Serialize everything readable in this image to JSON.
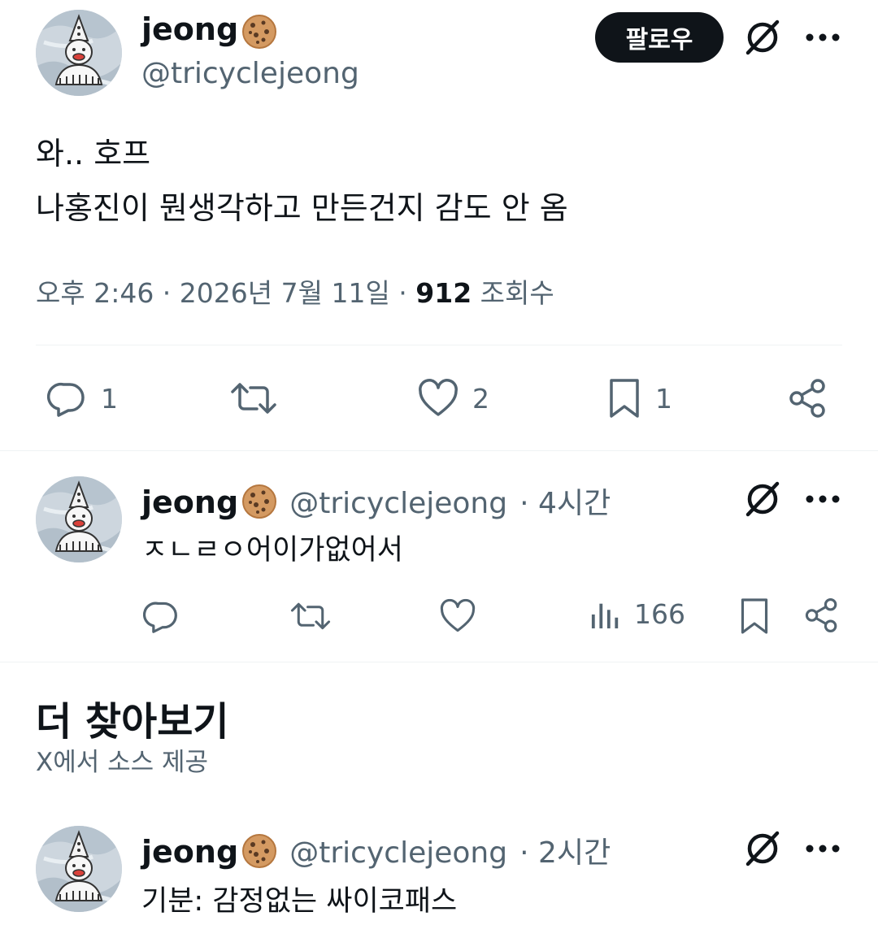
{
  "main_tweet": {
    "display_name": "jeong",
    "handle": "@tricyclejeong",
    "follow_label": "팔로우",
    "text_line1": "와.. 호프",
    "text_line2": "나홍진이 뭔생각하고 만든건지 감도 안 옴",
    "time": "오후 2:46 · 2026년 7월 11일 · ",
    "views": "912",
    "views_label": " 조회수",
    "actions": {
      "replies": "1",
      "likes": "2",
      "bookmarks": "1"
    }
  },
  "reply": {
    "display_name": "jeong",
    "handle": "@tricyclejeong",
    "time": "· 4시간",
    "text": "ㅈㄴㄹㅇ어이가없어서",
    "views": "166"
  },
  "more_section": {
    "title": "더 찾아보기",
    "subtitle": "X에서 소스 제공"
  },
  "suggested": {
    "display_name": "jeong",
    "handle": "@tricyclejeong",
    "time": "· 2시간",
    "text": "기분: 감정없는 싸이코패스"
  },
  "colors": {
    "text": "#0f1419",
    "muted": "#536471",
    "divider": "#eff3f4",
    "button": "#0f1419"
  },
  "icons": [
    "grok-icon",
    "more-icon",
    "reply-icon",
    "retweet-icon",
    "like-icon",
    "bookmark-icon",
    "share-icon",
    "views-icon",
    "cookie-emoji"
  ]
}
